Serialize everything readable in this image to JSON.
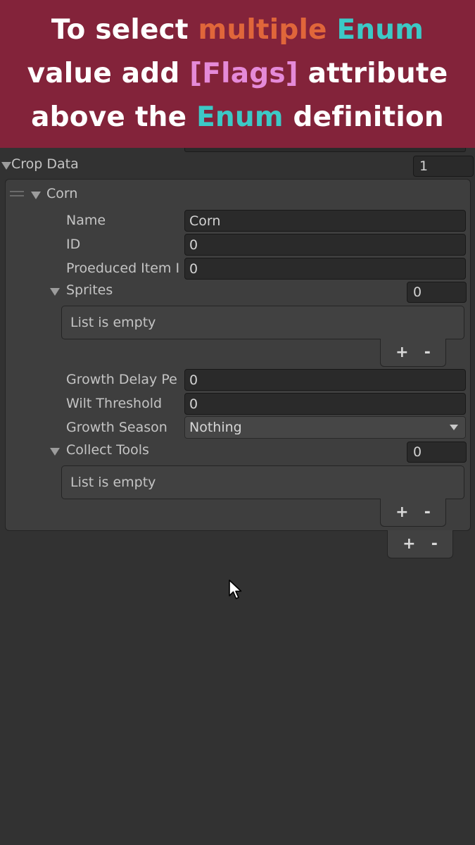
{
  "banner": {
    "line1": [
      "To select ",
      "multiple",
      " ",
      "Enum"
    ],
    "line2": [
      "value add ",
      "[Flags]",
      " attribute"
    ],
    "line3": [
      "above the ",
      "Enum",
      " definition"
    ],
    "colors": {
      "background": "#83233a",
      "orange": "#e0663a",
      "cyan": "#3cc9c6",
      "pink": "#e58ad8"
    }
  },
  "inspector": {
    "crop_data": {
      "label": "Crop Data",
      "count": "1"
    },
    "element": {
      "title": "Corn",
      "name": {
        "label": "Name",
        "value": "Corn"
      },
      "id": {
        "label": "ID",
        "value": "0"
      },
      "produced_item": {
        "label": "Proeduced Item I",
        "value": "0"
      },
      "sprites": {
        "label": "Sprites",
        "count": "0",
        "empty_text": "List is empty",
        "add": "+",
        "remove": "-"
      },
      "growth_delay": {
        "label": "Growth Delay Pe",
        "value": "0"
      },
      "wilt_threshold": {
        "label": "Wilt Threshold",
        "value": "0"
      },
      "growth_season": {
        "label": "Growth Season",
        "value": "Nothing"
      },
      "collect_tools": {
        "label": "Collect Tools",
        "count": "0",
        "empty_text": "List is empty",
        "add": "+",
        "remove": "-"
      }
    },
    "outer_list_buttons": {
      "add": "+",
      "remove": "-"
    }
  },
  "icons": [
    "foldout-arrow-icon",
    "drag-handle-icon",
    "dropdown-caret-icon",
    "mouse-cursor-icon"
  ]
}
